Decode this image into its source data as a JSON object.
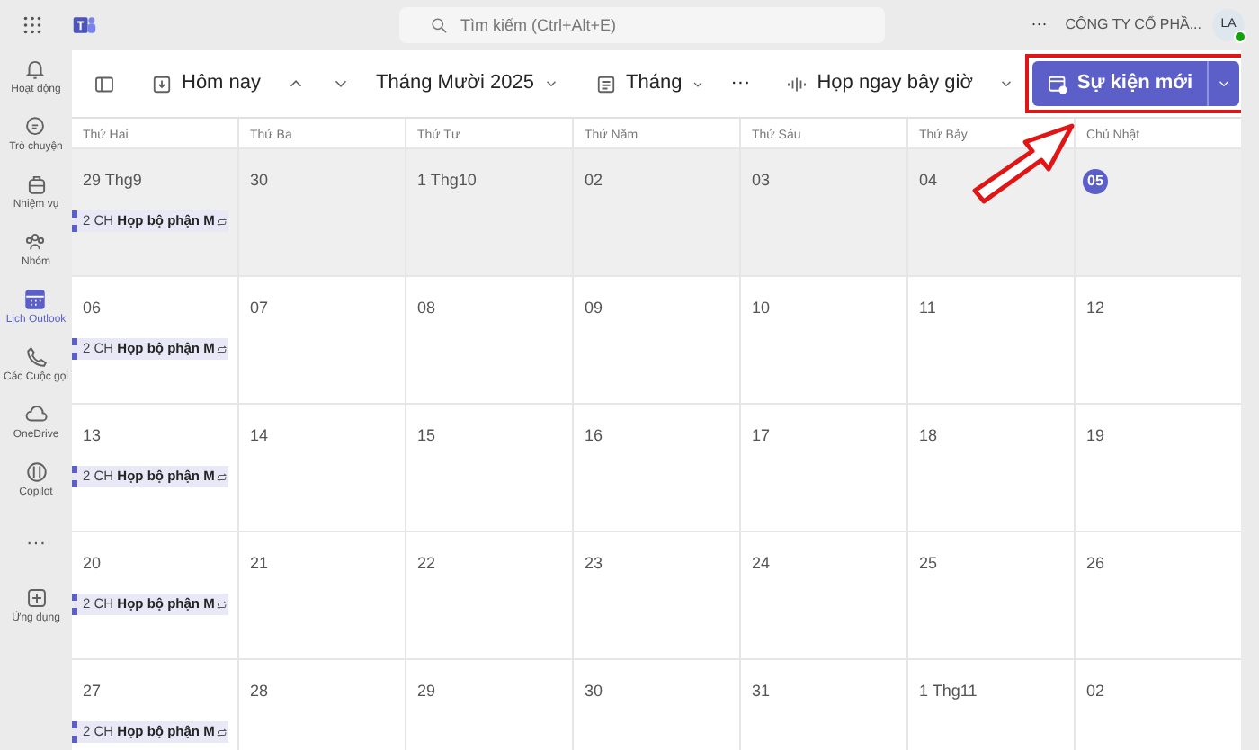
{
  "topbar": {
    "search_placeholder": "Tìm kiếm (Ctrl+Alt+E)",
    "more": "···",
    "org": "CÔNG TY CỔ PHẦ...",
    "avatar": "LA"
  },
  "rail": [
    {
      "label": "Hoạt động",
      "selected": false
    },
    {
      "label": "Trò chuyện",
      "selected": false
    },
    {
      "label": "Nhiệm vụ",
      "selected": false
    },
    {
      "label": "Nhóm",
      "selected": false
    },
    {
      "label": "Lịch Outlook",
      "selected": true
    },
    {
      "label": "Các Cuộc gọi",
      "selected": false
    },
    {
      "label": "OneDrive",
      "selected": false
    },
    {
      "label": "Copilot",
      "selected": false
    },
    {
      "label": "···",
      "selected": false
    },
    {
      "label": "Ứng dụng",
      "selected": false
    }
  ],
  "toolbar": {
    "today": "Hôm nay",
    "month_title": "Tháng Mười 2025",
    "view": "Tháng",
    "more": "···",
    "meet_now": "Họp ngay bây giờ",
    "new_event": "Sự kiện mới"
  },
  "weekdays": [
    "Thứ Hai",
    "Thứ Ba",
    "Thứ Tư",
    "Thứ Năm",
    "Thứ Sáu",
    "Thứ Bảy",
    "Chủ Nhật"
  ],
  "weeks": [
    {
      "shaded": true,
      "days": [
        {
          "label": "29 Thg9",
          "today": false,
          "events": [
            "2 CH **Họp bộ phận M**"
          ]
        },
        {
          "label": "30",
          "today": false
        },
        {
          "label": "1 Thg10",
          "today": false
        },
        {
          "label": "02",
          "today": false
        },
        {
          "label": "03",
          "today": false
        },
        {
          "label": "04",
          "today": false
        },
        {
          "label": "05",
          "today": true
        }
      ]
    },
    {
      "shaded": false,
      "days": [
        {
          "label": "06",
          "today": false,
          "events": [
            "2 CH **Họp bộ phận M**"
          ]
        },
        {
          "label": "07",
          "today": false
        },
        {
          "label": "08",
          "today": false
        },
        {
          "label": "09",
          "today": false
        },
        {
          "label": "10",
          "today": false
        },
        {
          "label": "11",
          "today": false
        },
        {
          "label": "12",
          "today": false
        }
      ]
    },
    {
      "shaded": false,
      "days": [
        {
          "label": "13",
          "today": false,
          "events": [
            "2 CH **Họp bộ phận M**"
          ]
        },
        {
          "label": "14",
          "today": false
        },
        {
          "label": "15",
          "today": false
        },
        {
          "label": "16",
          "today": false
        },
        {
          "label": "17",
          "today": false
        },
        {
          "label": "18",
          "today": false
        },
        {
          "label": "19",
          "today": false
        }
      ]
    },
    {
      "shaded": false,
      "days": [
        {
          "label": "20",
          "today": false,
          "events": [
            "2 CH **Họp bộ phận M**"
          ]
        },
        {
          "label": "21",
          "today": false
        },
        {
          "label": "22",
          "today": false
        },
        {
          "label": "23",
          "today": false
        },
        {
          "label": "24",
          "today": false
        },
        {
          "label": "25",
          "today": false
        },
        {
          "label": "26",
          "today": false
        }
      ]
    },
    {
      "shaded": false,
      "days": [
        {
          "label": "27",
          "today": false,
          "events": [
            "2 CH **Họp bộ phận M**"
          ]
        },
        {
          "label": "28",
          "today": false
        },
        {
          "label": "29",
          "today": false
        },
        {
          "label": "30",
          "today": false
        },
        {
          "label": "31",
          "today": false
        },
        {
          "label": "1 Thg11",
          "today": false
        },
        {
          "label": "02",
          "today": false
        }
      ]
    }
  ]
}
